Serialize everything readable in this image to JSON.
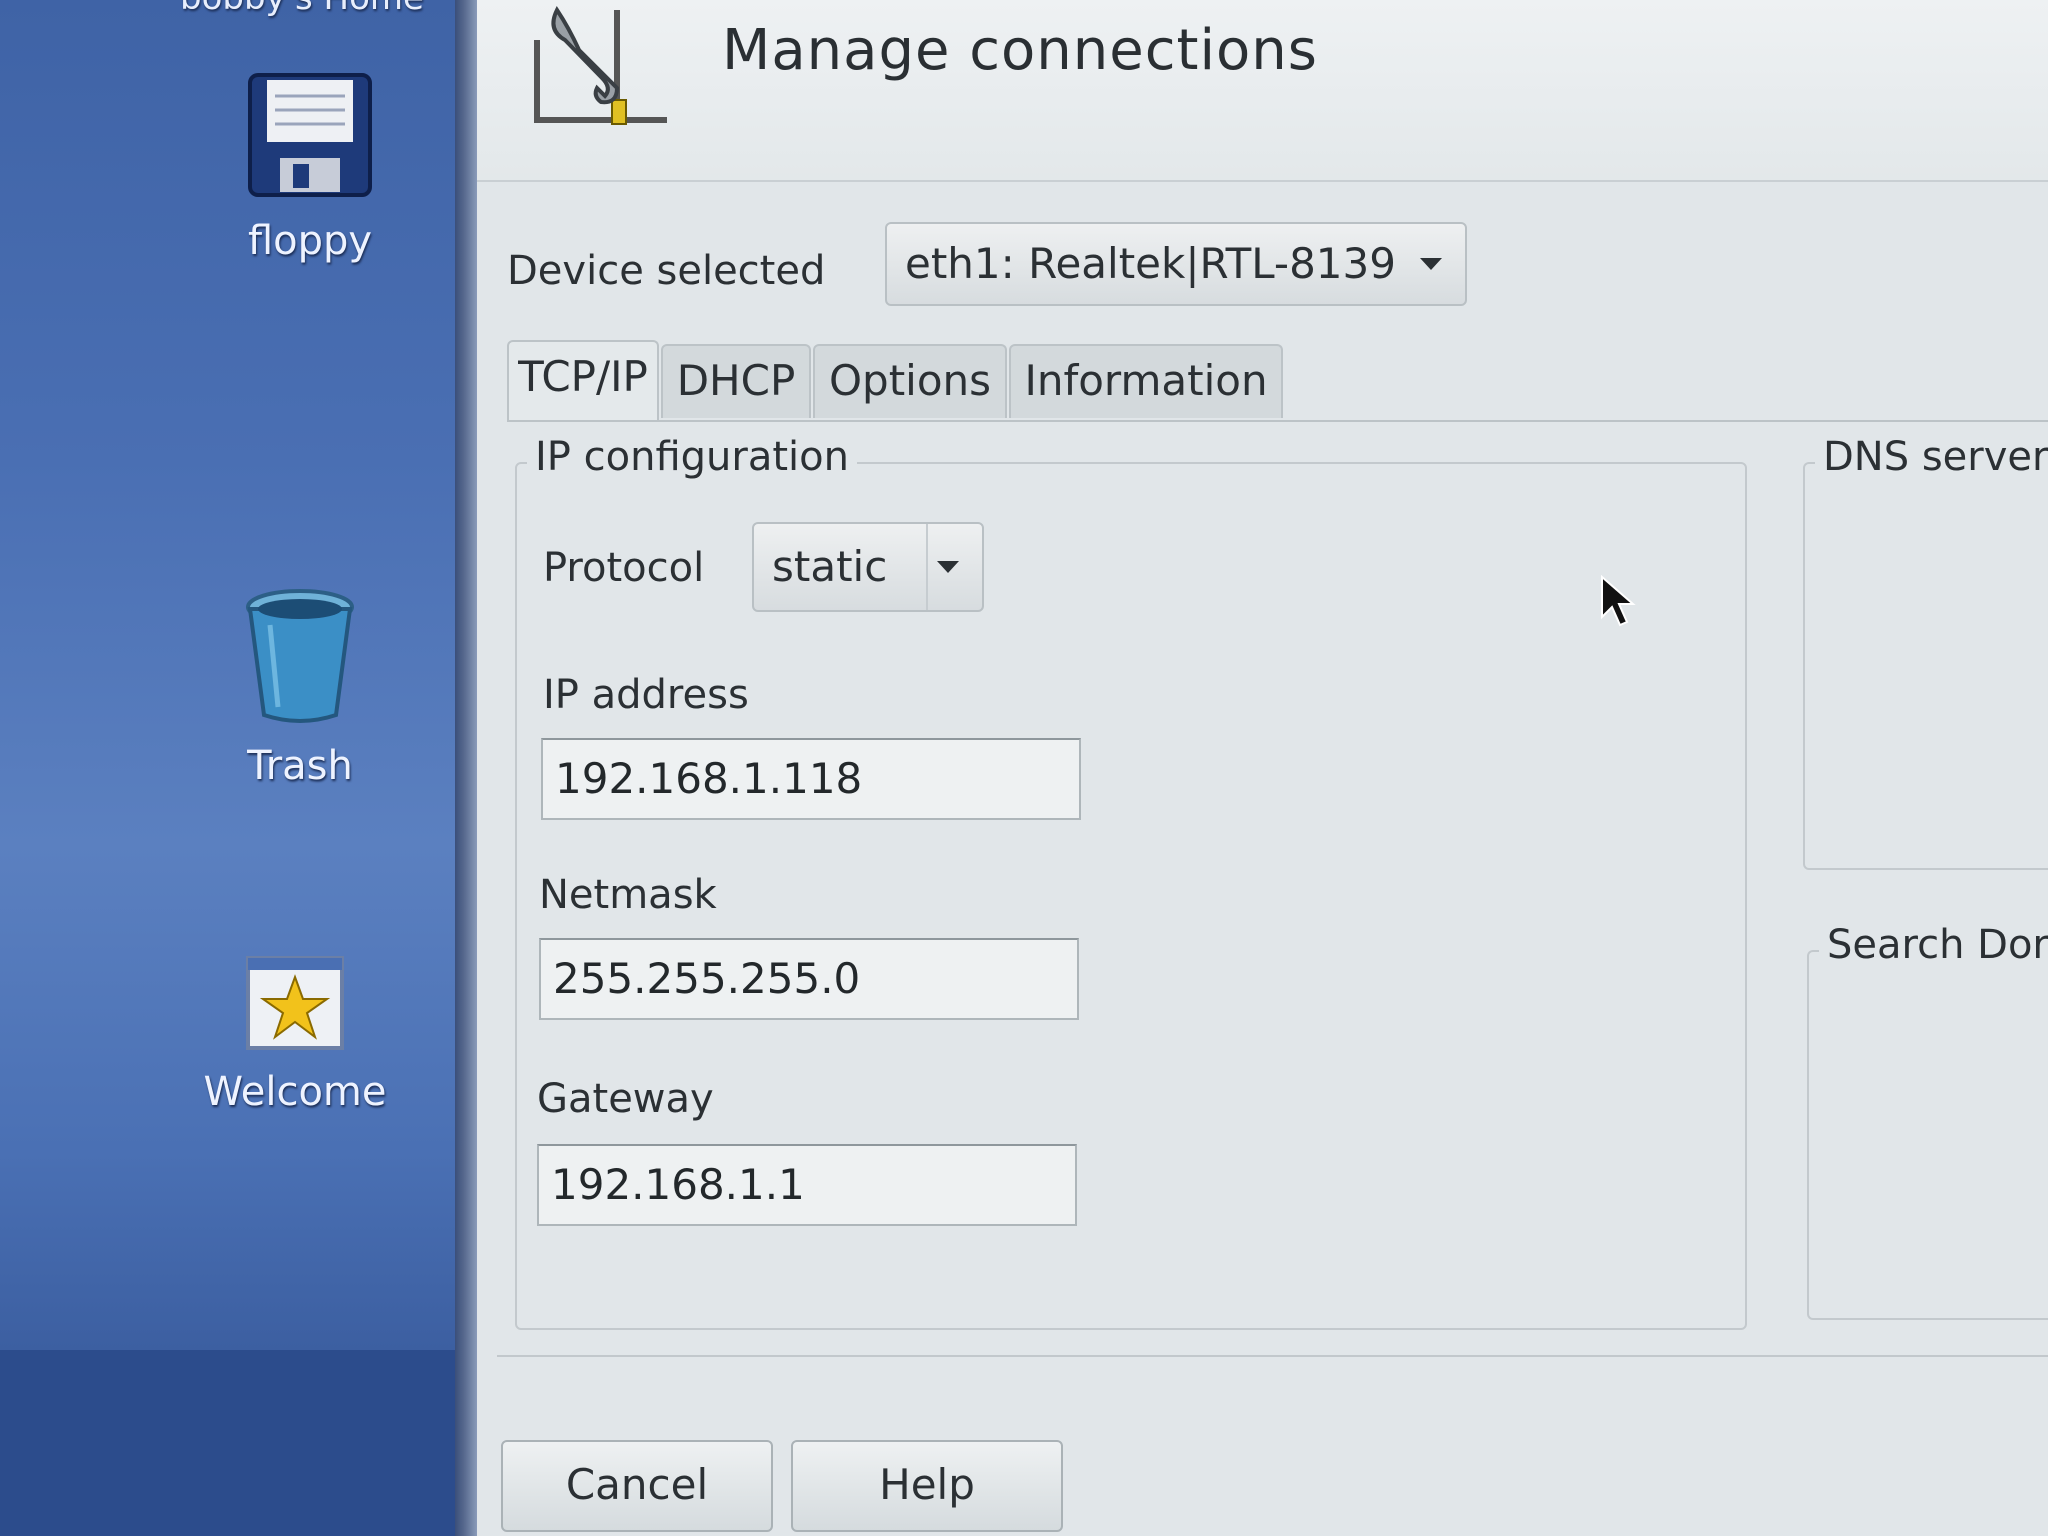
{
  "desktop": {
    "home_label": "bobby's Home",
    "icons": [
      {
        "label": "floppy",
        "icon": "floppy-disk-icon"
      },
      {
        "label": "Trash",
        "icon": "trash-icon"
      },
      {
        "label": "Welcome",
        "icon": "star-icon"
      }
    ]
  },
  "dialog": {
    "title": "Manage connections",
    "icon": "wrench-network-icon",
    "device_selected_label": "Device selected",
    "device_selected_value": "eth1: Realtek|RTL-8139",
    "tabs": [
      {
        "label": "TCP/IP",
        "active": true
      },
      {
        "label": "DHCP",
        "active": false
      },
      {
        "label": "Options",
        "active": false
      },
      {
        "label": "Information",
        "active": false
      }
    ],
    "ip_config": {
      "title": "IP configuration",
      "protocol_label": "Protocol",
      "protocol_value": "static",
      "ip_address_label": "IP address",
      "ip_address_value": "192.168.1.118",
      "netmask_label": "Netmask",
      "netmask_value": "255.255.255.0",
      "gateway_label": "Gateway",
      "gateway_value": "192.168.1.1"
    },
    "dns_servers_title": "DNS servers",
    "search_domains_title": "Search Dor",
    "buttons": {
      "cancel": "Cancel",
      "help": "Help"
    }
  },
  "colors": {
    "desktop_blue": "#4a6fb3",
    "dialog_bg": "#e1e6e9",
    "field_bg": "#eef1f2"
  }
}
